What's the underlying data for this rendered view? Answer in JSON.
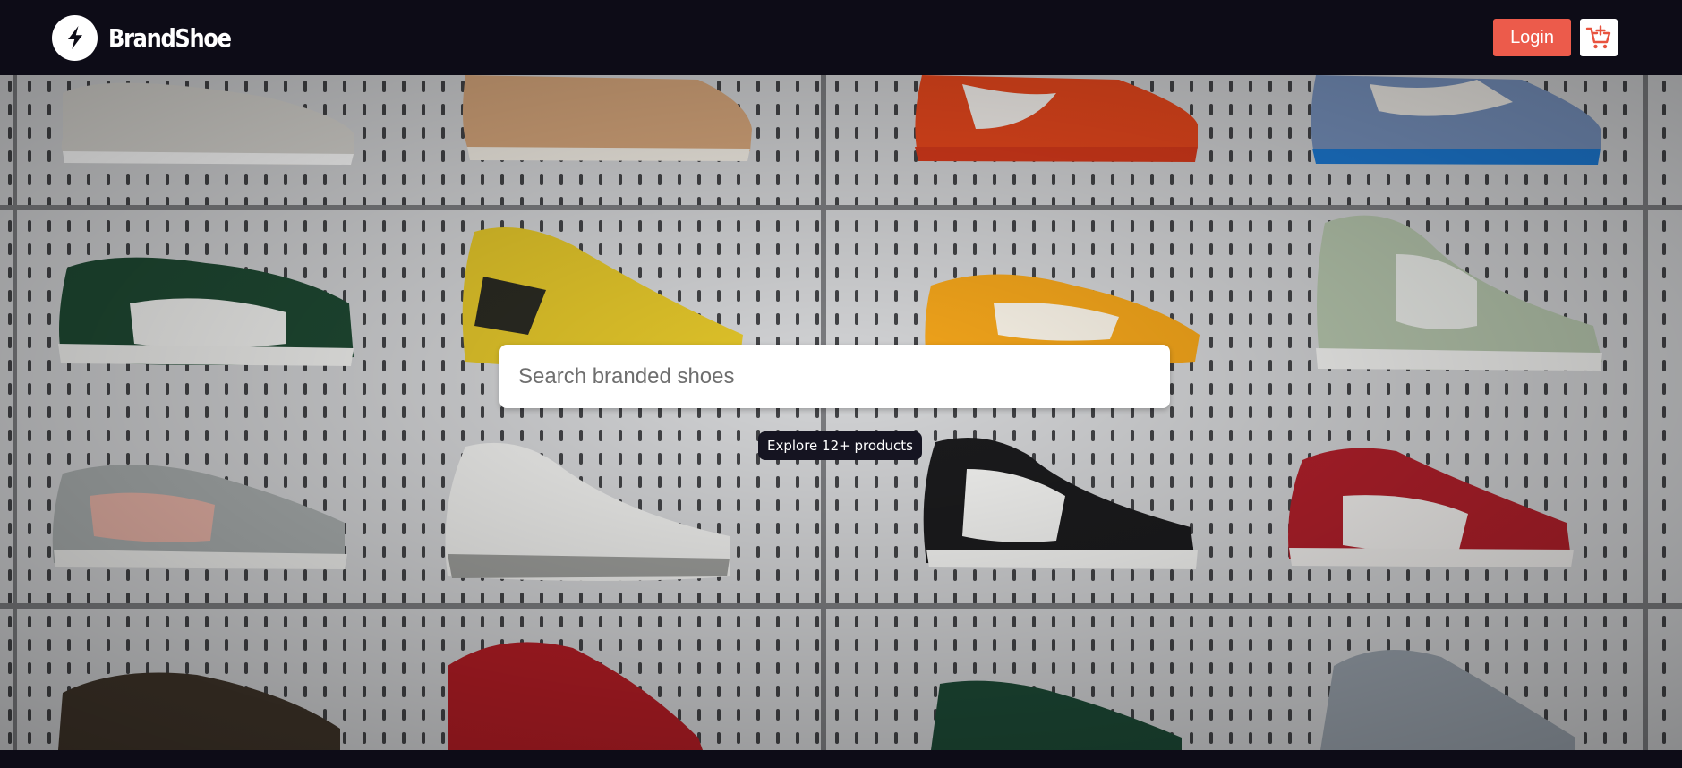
{
  "brand": {
    "name": "BrandShoe",
    "logo_icon": "lightning-bolt-icon"
  },
  "nav": {
    "login_label": "Login",
    "cart_icon": "add-to-cart-icon"
  },
  "hero": {
    "background": "sneaker-wall-photo",
    "search": {
      "placeholder": "Search branded shoes",
      "value": ""
    },
    "badge": "Explore 12+ products"
  },
  "colors": {
    "nav_bg": "#0d0c17",
    "accent": "#ec5b4b",
    "badge_bg": "#151421"
  }
}
